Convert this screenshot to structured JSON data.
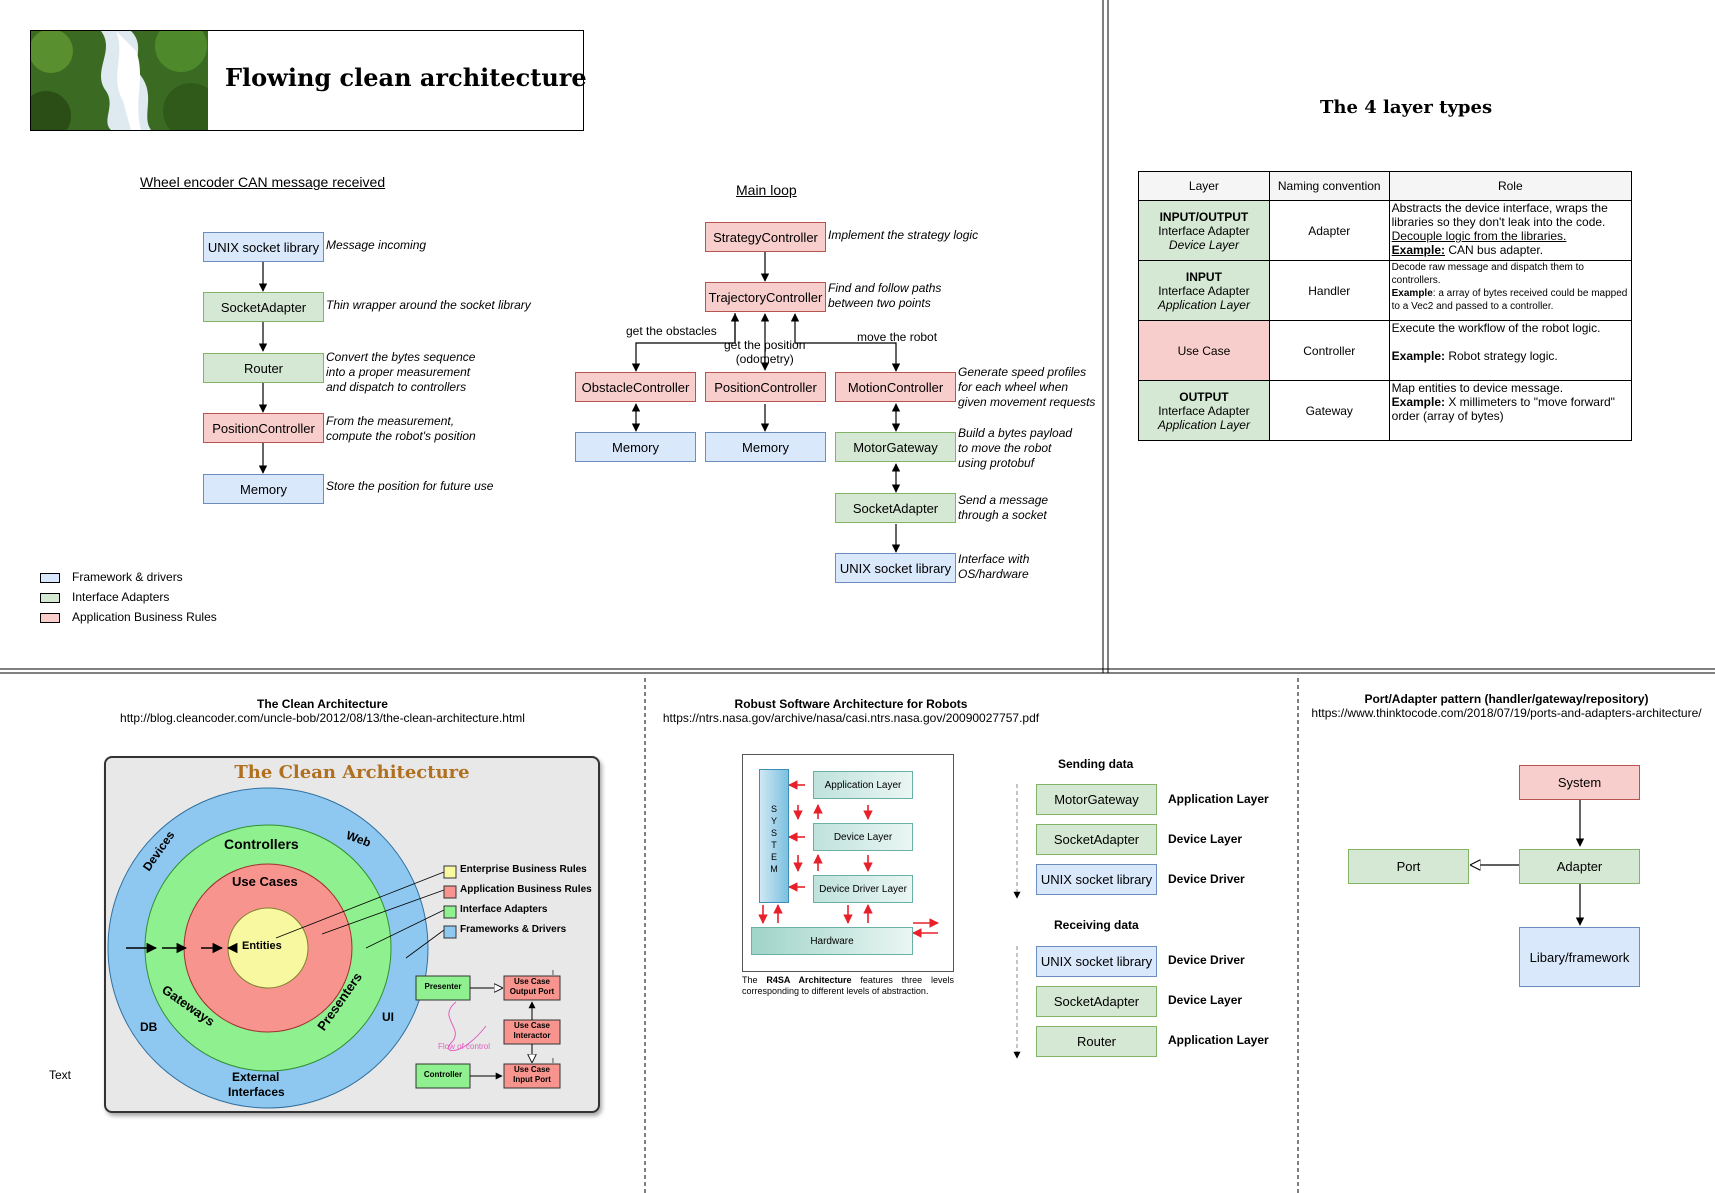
{
  "header": {
    "title": "Flowing clean architecture",
    "subtitle": "The 4 layer types"
  },
  "wheel_flow": {
    "title": "Wheel encoder CAN message received",
    "nodes": [
      "UNIX socket library",
      "SocketAdapter",
      "Router",
      "PositionController",
      "Memory"
    ],
    "notes": [
      "Message incoming",
      "Thin wrapper around the socket library",
      "Convert the bytes sequence\ninto a proper measurement\nand dispatch to controllers",
      "From the measurement,\ncompute the robot's position",
      "Store the position for future use"
    ]
  },
  "main_loop": {
    "title": "Main loop",
    "strategy": "StrategyController",
    "strategy_note": "Implement the strategy logic",
    "trajectory": "TrajectoryController",
    "trajectory_note": "Find and follow paths\nbetween two points",
    "edge_obstacles": "get the obstacles",
    "edge_position": "get the position\n(odometry)",
    "edge_move": "move the robot",
    "obstacle": "ObstacleController",
    "position": "PositionController",
    "motion": "MotionController",
    "motion_note": "Generate speed profiles\nfor each wheel when\ngiven movement requests",
    "memory1": "Memory",
    "memory2": "Memory",
    "motor_gateway": "MotorGateway",
    "motor_gateway_note": "Build a bytes payload\nto move the robot\nusing protobuf",
    "socket_adapter": "SocketAdapter",
    "socket_adapter_note": "Send a message\nthrough a socket",
    "unix_socket": "UNIX socket library",
    "unix_socket_note": "Interface with\nOS/hardware"
  },
  "legend": {
    "items": [
      {
        "label": "Framework & drivers",
        "color": "#dae8fc"
      },
      {
        "label": "Interface Adapters",
        "color": "#d5e8d4"
      },
      {
        "label": "Application Business Rules",
        "color": "#f8cecc"
      }
    ]
  },
  "layer_table": {
    "headers": [
      "Layer",
      "Naming convention",
      "Role"
    ],
    "rows": [
      {
        "layer_bold": "INPUT/OUTPUT",
        "layer_line2": "Interface Adapter",
        "layer_line3": "Device Layer",
        "naming": "Adapter",
        "role": "Abstracts the device interface, wraps the libraries so they don't leak into the code.",
        "role_u": "Decouple logic from the libraries.",
        "role_ex_label": "Example:",
        "role_ex": "CAN bus adapter."
      },
      {
        "layer_bold": "INPUT",
        "layer_line2": "Interface Adapter",
        "layer_line3": "Application Layer",
        "naming": "Handler",
        "role": "Decode raw message and dispatch them to controllers.",
        "role_ex_label": "Example",
        "role_ex": ": a array of bytes received could be mapped to a Vec2 and passed to a controller."
      },
      {
        "layer_bold": "",
        "layer_line2": "Use Case",
        "layer_line3": "",
        "naming": "Controller",
        "role": "Execute the workflow of the robot logic.",
        "role_ex_label": "Example:",
        "role_ex": "Robot strategy logic."
      },
      {
        "layer_bold": "OUTPUT",
        "layer_line2": "Interface Adapter",
        "layer_line3": "Application Layer",
        "naming": "Gateway",
        "role": "Map entities to device message.",
        "role_ex_label": "Example:",
        "role_ex": "X millimeters to \"move forward\" order (array of bytes)"
      }
    ]
  },
  "clean_arch": {
    "title": "The Clean Architecture",
    "url": "http://blog.cleancoder.com/uncle-bob/2012/08/13/the-clean-architecture.html",
    "image_title": "The Clean Architecture",
    "ring_labels": {
      "devices": "Devices",
      "web": "Web",
      "controllers": "Controllers",
      "use_cases": "Use Cases",
      "entities": "Entities",
      "gateways": "Gateways",
      "presenters": "Presenters",
      "ui": "UI",
      "db": "DB",
      "external": "External",
      "interfaces": "Interfaces"
    },
    "legend": [
      "Enterprise Business Rules",
      "Application Business Rules",
      "Interface Adapters",
      "Frameworks & Drivers"
    ],
    "flow": {
      "presenter": "Presenter",
      "uc_output_1": "Use Case",
      "uc_output_2": "Output Port",
      "uc_interactor_1": "Use Case",
      "uc_interactor_2": "Interactor",
      "controller": "Controller",
      "uc_input_1": "Use Case",
      "uc_input_2": "Input Port",
      "flow_label": "Flow of control",
      "i_mark": "I"
    },
    "stray_text": "Text"
  },
  "robust": {
    "title": "Robust Software Architecture for Robots",
    "url": "https://ntrs.nasa.gov/archive/nasa/casi.ntrs.nasa.gov/20090027757.pdf",
    "system": "SYSTEM",
    "layers": [
      "Application Layer",
      "Device Layer",
      "Device Driver Layer",
      "Hardware"
    ],
    "caption_pre": "The",
    "caption_bold": "R4SA Architecture",
    "caption_post": "features three levels corresponding to different levels of abstraction.",
    "sending_title": "Sending data",
    "sending": [
      {
        "node": "MotorGateway",
        "label": "Application Layer"
      },
      {
        "node": "SocketAdapter",
        "label": "Device Layer"
      },
      {
        "node": "UNIX socket library",
        "label": "Device Driver"
      }
    ],
    "receiving_title": "Receiving data",
    "receiving": [
      {
        "node": "UNIX socket library",
        "label": "Device Driver"
      },
      {
        "node": "SocketAdapter",
        "label": "Device Layer"
      },
      {
        "node": "Router",
        "label": "Application Layer"
      }
    ]
  },
  "port_adapter": {
    "title": "Port/Adapter pattern (handler/gateway/repository)",
    "url": "https://www.thinktocode.com/2018/07/19/ports-and-adapters-architecture/",
    "system": "System",
    "port": "Port",
    "adapter": "Adapter",
    "library": "Libary/framework"
  }
}
